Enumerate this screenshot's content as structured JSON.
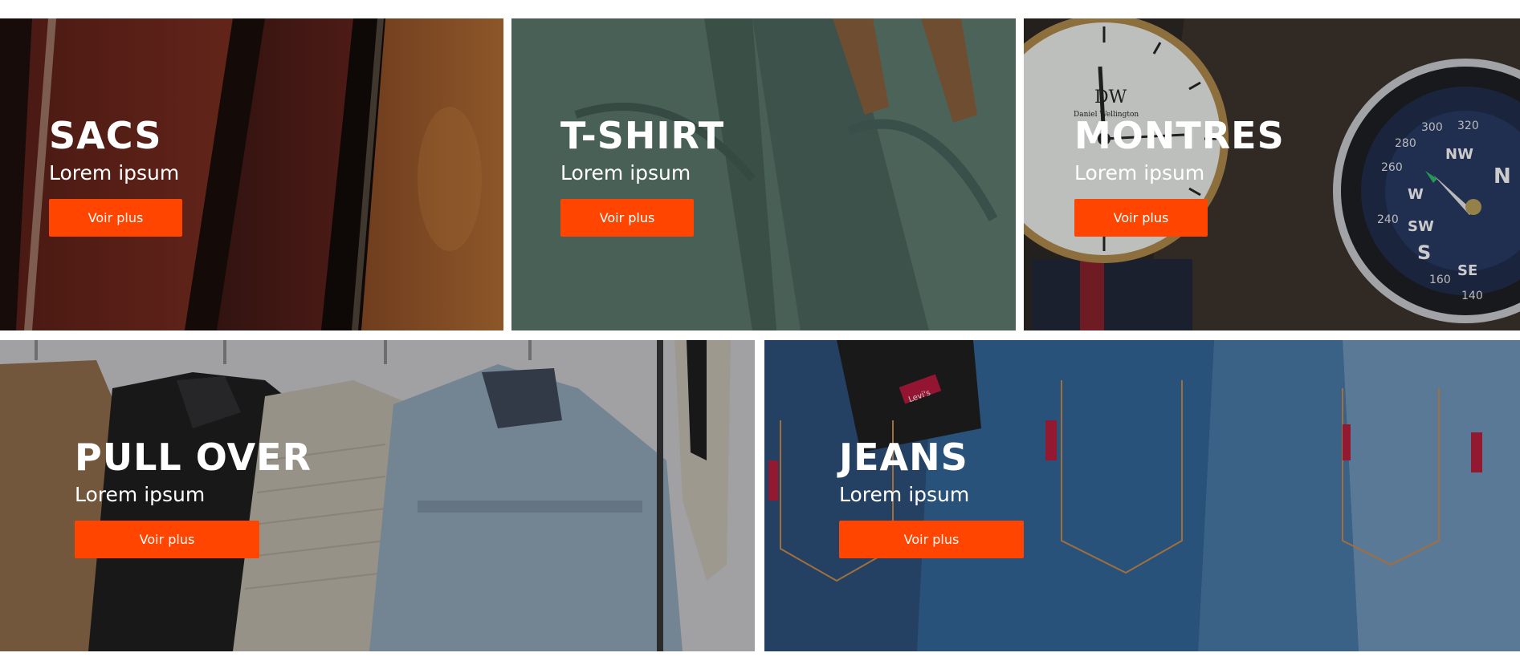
{
  "categories": [
    {
      "title": "SACS",
      "subtitle": "Lorem ipsum",
      "button": "Voir plus",
      "image": "leather-bags-photo"
    },
    {
      "title": "T-SHIRT",
      "subtitle": "Lorem ipsum",
      "button": "Voir plus",
      "image": "green-tshirts-on-hangers-photo"
    },
    {
      "title": "MONTRES",
      "subtitle": "Lorem ipsum",
      "button": "Voir plus",
      "image": "watch-and-compass-photo"
    },
    {
      "title": "PULL OVER",
      "subtitle": "Lorem ipsum",
      "button": "Voir plus",
      "image": "jackets-on-rack-photo"
    },
    {
      "title": "JEANS",
      "subtitle": "Lorem ipsum",
      "button": "Voir plus",
      "image": "denim-jeans-pockets-photo"
    }
  ],
  "watch": {
    "brand": "DW",
    "brand_line": "Daniel Wellington"
  },
  "compass": {
    "dial_numbers": [
      "300",
      "320",
      "280",
      "260",
      "240",
      "160",
      "140"
    ],
    "letters": [
      "N",
      "NW",
      "W",
      "SW",
      "S",
      "SE"
    ]
  },
  "jeans_tags": {
    "label": "Levi's"
  },
  "colors": {
    "accent": "#ff4500",
    "text": "#ffffff"
  }
}
